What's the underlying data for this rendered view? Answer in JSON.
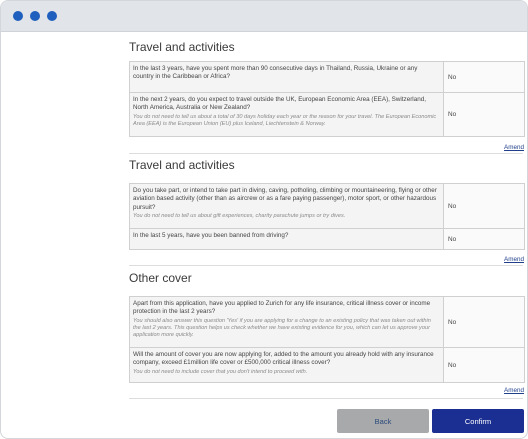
{
  "sections": [
    {
      "title": "Travel and activities",
      "rows": [
        {
          "question": "In the last 3 years, have you spent more than 90 consecutive days in Thailand, Russia, Ukraine or any country in the Caribbean or Africa?",
          "note": "",
          "answer": "No"
        },
        {
          "question": "In the next 2 years, do you expect to travel outside the UK, European Economic Area (EEA), Switzerland, North America, Australia or New Zealand?",
          "note": "You do not need to tell us about a total of 30 days holiday each year or the reason for your travel. The European Economic Area (EEA) is the European Union (EU) plus Iceland, Liechtenstein & Norway.",
          "answer": "No"
        }
      ],
      "amend": "Amend"
    },
    {
      "title": "Travel and activities",
      "rows": [
        {
          "question": "Do you take part, or intend to take part in diving, caving, potholing, climbing or mountaineering, flying or other aviation based activity (other than as aircrew or as a fare paying passenger), motor sport, or other hazardous pursuit?",
          "note": "You do not need to tell us about gift experiences, charity parachute jumps or try dives.",
          "answer": "No"
        },
        {
          "question": "In the last 5 years, have you been banned from driving?",
          "note": "",
          "answer": "No"
        }
      ],
      "amend": "Amend"
    },
    {
      "title": "Other cover",
      "rows": [
        {
          "question": "Apart from this application, have you applied to Zurich for any life insurance, critical illness cover or income protection in the last 2 years?",
          "note": "You should also answer this question 'Yes' if you are applying for a change to an existing policy that was taken out within the last 2 years. This question helps us check whether we have existing evidence for you, which can let us approve your application more quickly.",
          "answer": "No"
        },
        {
          "question": "Will the amount of cover you are now applying for, added to the amount you already hold with any insurance company, exceed £1million life cover or £500,000 critical illness cover?",
          "note": "You do not need to include cover that you don't intend to proceed with.",
          "answer": "No"
        }
      ],
      "amend": "Amend"
    }
  ],
  "buttons": {
    "back": "Back",
    "confirm": "Confirm"
  },
  "colors": {
    "accent": "#1b2f92",
    "window_dots": "#1f5fbd",
    "back_button": "#a7a9ab"
  }
}
